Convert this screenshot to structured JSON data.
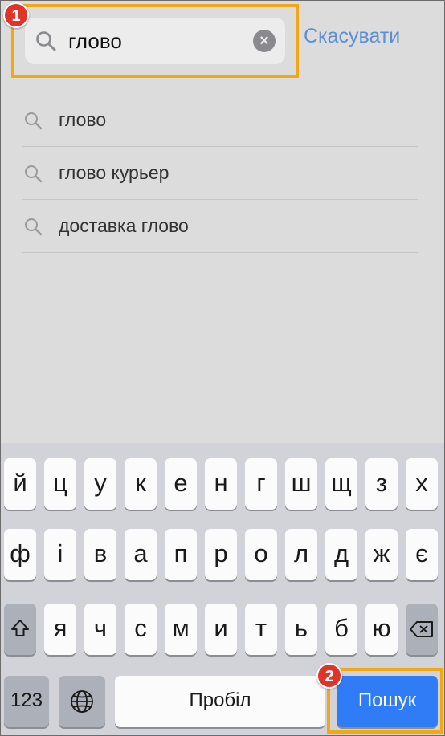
{
  "search": {
    "query": "глово",
    "cancel_label": "Скасувати"
  },
  "annotations": {
    "badge_1": "1",
    "badge_2": "2"
  },
  "suggestions": [
    {
      "text": "глово"
    },
    {
      "text": "глово курьер"
    },
    {
      "text": "доставка глово"
    }
  ],
  "keyboard": {
    "row1": [
      "й",
      "ц",
      "у",
      "к",
      "е",
      "н",
      "г",
      "ш",
      "щ",
      "з",
      "х"
    ],
    "row2": [
      "ф",
      "і",
      "в",
      "а",
      "п",
      "р",
      "о",
      "л",
      "д",
      "ж",
      "є"
    ],
    "row3": [
      "я",
      "ч",
      "с",
      "м",
      "и",
      "т",
      "ь",
      "б",
      "ю"
    ],
    "numbers_label": "123",
    "space_label": "Пробіл",
    "search_label": "Пошук",
    "shift_icon": "shift-icon",
    "backspace_icon": "backspace-icon",
    "globe_icon": "globe-icon"
  },
  "colors": {
    "accent": "#5b8fd6",
    "highlight": "#f3a712",
    "badge": "#e0332a",
    "go_key": "#2f7cf6"
  }
}
